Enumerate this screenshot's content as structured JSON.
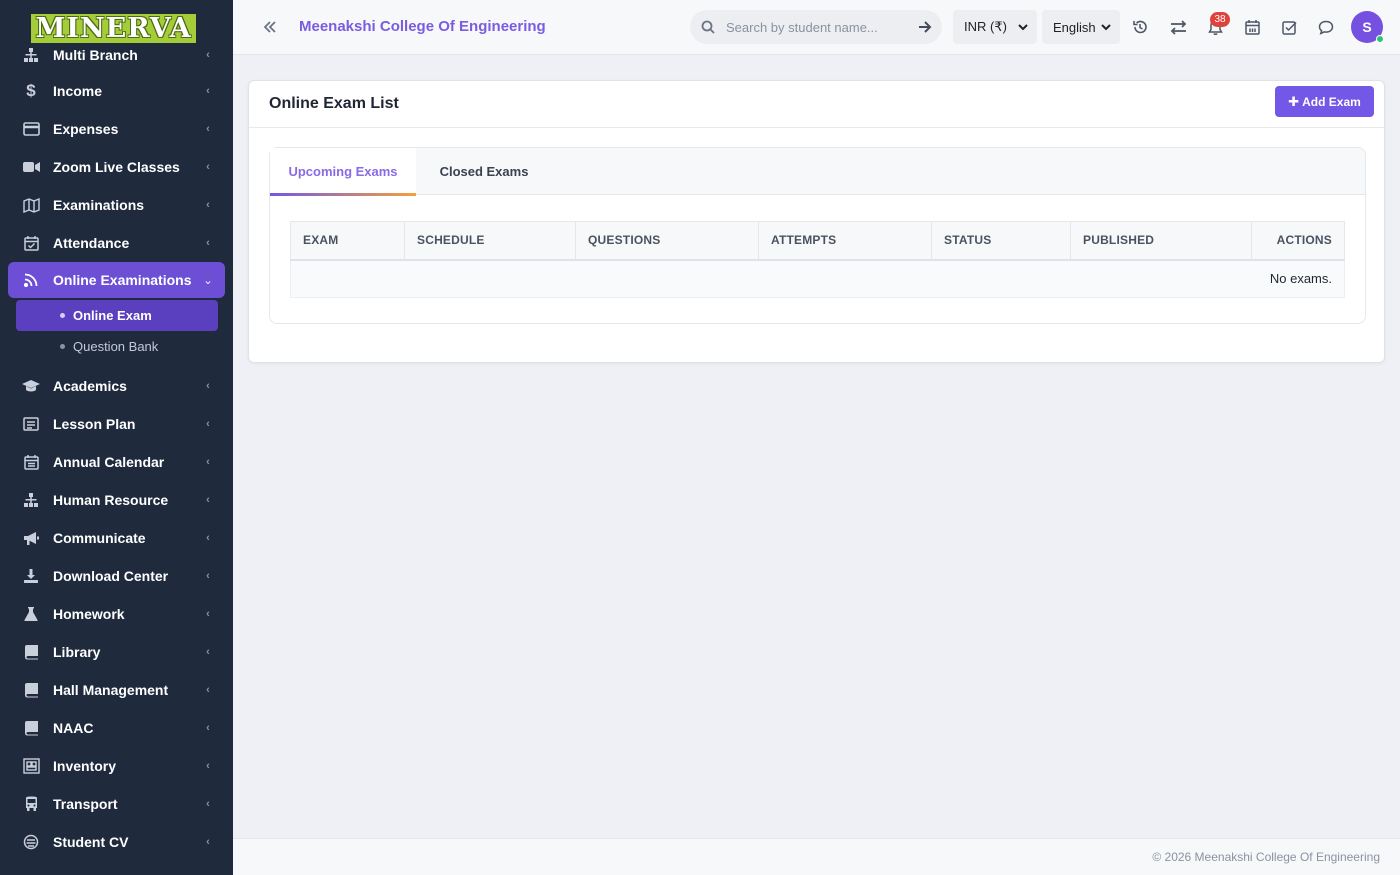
{
  "brand": {
    "logo_text": "MINERVA"
  },
  "sidebar": {
    "items": [
      {
        "label": "Multi Branch",
        "icon": "sitemap-icon"
      },
      {
        "label": "Income",
        "icon": "dollar-icon"
      },
      {
        "label": "Expenses",
        "icon": "credit-card-icon"
      },
      {
        "label": "Zoom Live Classes",
        "icon": "video-icon"
      },
      {
        "label": "Examinations",
        "icon": "map-icon"
      },
      {
        "label": "Attendance",
        "icon": "calendar-check-icon"
      },
      {
        "label": "Online Examinations",
        "icon": "rss-icon",
        "active": true
      },
      {
        "label": "Academics",
        "icon": "graduation-cap-icon"
      },
      {
        "label": "Lesson Plan",
        "icon": "list-icon"
      },
      {
        "label": "Annual Calendar",
        "icon": "calendar-icon"
      },
      {
        "label": "Human Resource",
        "icon": "org-chart-icon"
      },
      {
        "label": "Communicate",
        "icon": "bullhorn-icon"
      },
      {
        "label": "Download Center",
        "icon": "download-icon"
      },
      {
        "label": "Homework",
        "icon": "flask-icon"
      },
      {
        "label": "Library",
        "icon": "book-icon"
      },
      {
        "label": "Hall Management",
        "icon": "book-icon"
      },
      {
        "label": "NAAC",
        "icon": "book-icon"
      },
      {
        "label": "Inventory",
        "icon": "inventory-icon"
      },
      {
        "label": "Transport",
        "icon": "bus-icon"
      },
      {
        "label": "Student CV",
        "icon": "cv-icon"
      }
    ],
    "submenu": [
      {
        "label": "Online Exam",
        "active": true
      },
      {
        "label": "Question Bank"
      }
    ]
  },
  "header": {
    "college_name": "Meenakshi College Of Engineering",
    "search_placeholder": "Search by student name...",
    "currency": "INR (₹)",
    "language": "English",
    "notification_count": "38",
    "avatar_initial": "S"
  },
  "main": {
    "title": "Online Exam List",
    "add_button": "Add Exam",
    "tabs": [
      {
        "label": "Upcoming Exams",
        "active": true
      },
      {
        "label": "Closed Exams"
      }
    ],
    "table": {
      "columns": [
        "EXAM",
        "SCHEDULE",
        "QUESTIONS",
        "ATTEMPTS",
        "STATUS",
        "PUBLISHED",
        "ACTIONS"
      ],
      "empty_message": "No exams."
    }
  },
  "footer": {
    "text": "© 2026 Meenakshi College Of Engineering"
  },
  "colors": {
    "accent": "#7357e6",
    "sidebar_bg": "#1f2a3d",
    "sidebar_active": "#6d4fd6",
    "badge": "#e0413b",
    "logo_bg": "#a5cd39",
    "online": "#28c76f"
  }
}
